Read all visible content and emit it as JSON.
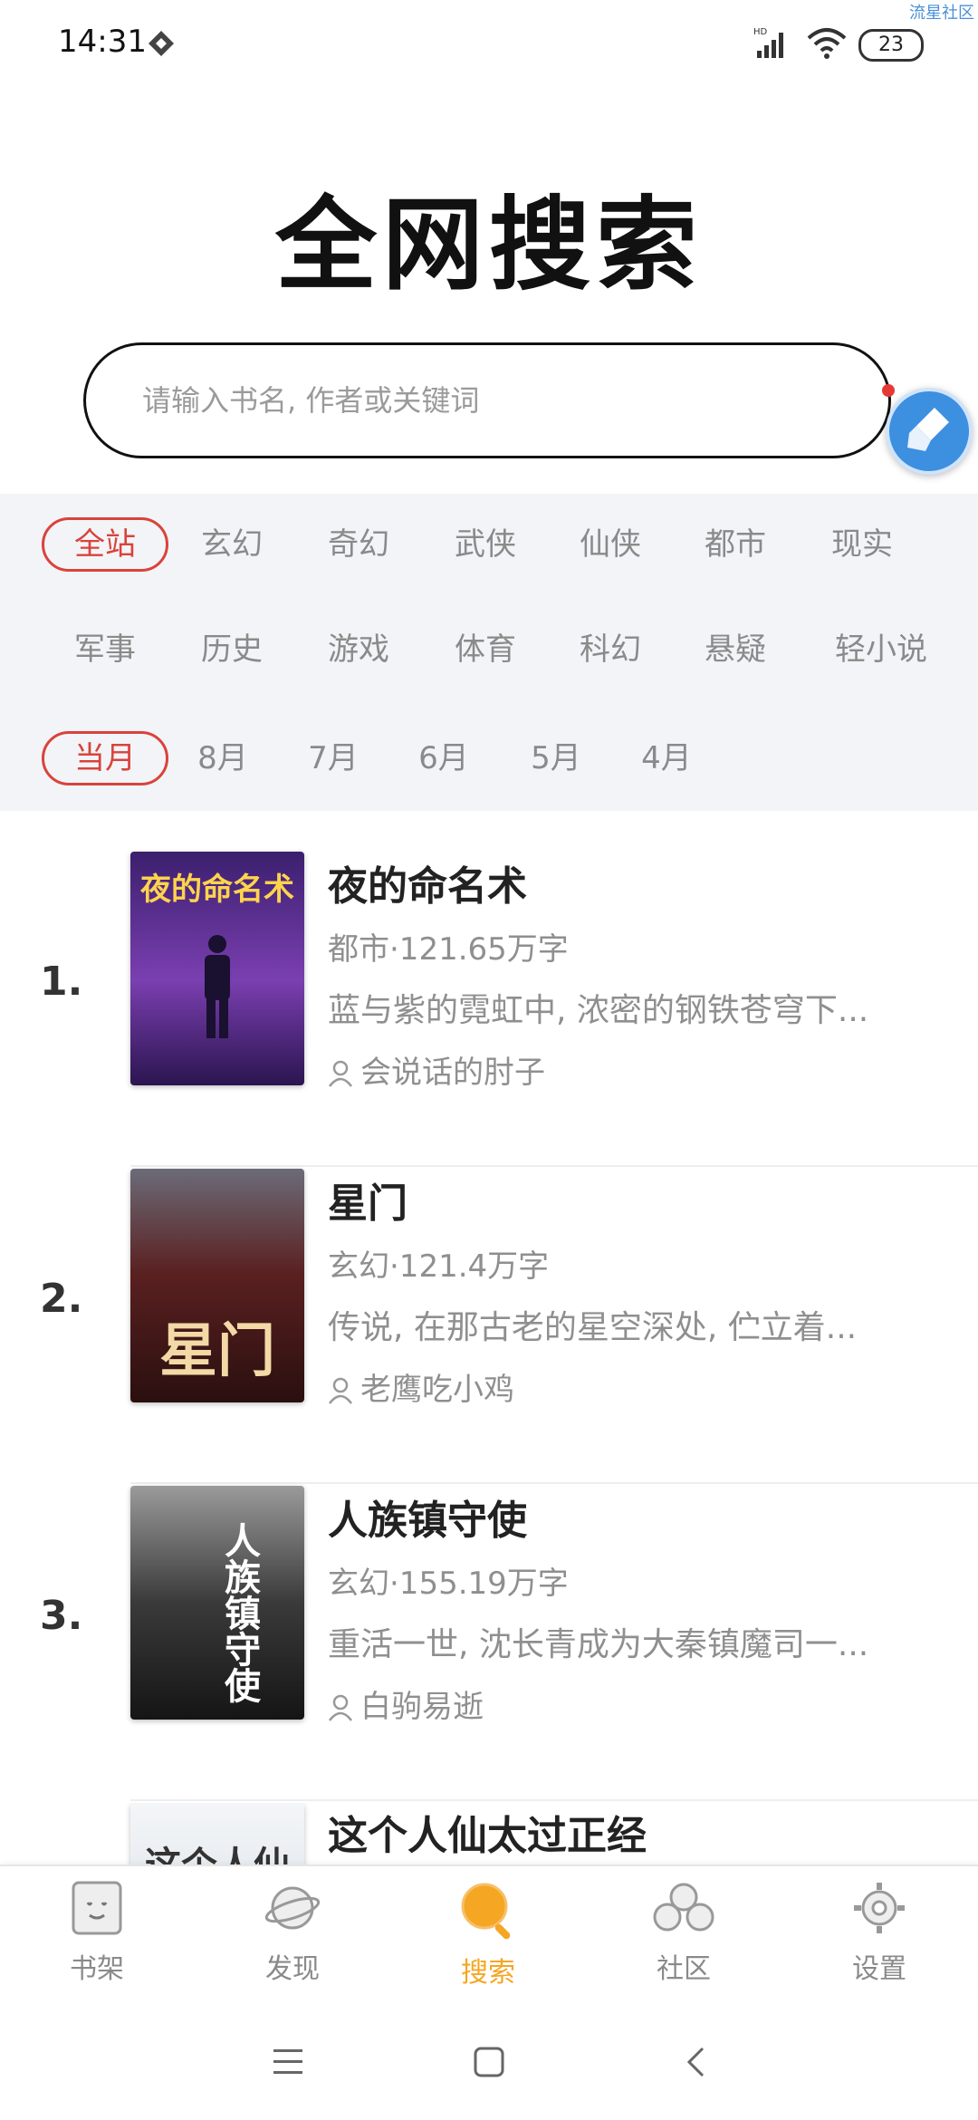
{
  "status_bar": {
    "time": "14:31",
    "battery": "23",
    "watermark": "流星社区"
  },
  "page_title": "全网搜索",
  "search": {
    "placeholder": "请输入书名, 作者或关键词"
  },
  "categories": [
    [
      "全站",
      "玄幻",
      "奇幻",
      "武侠",
      "仙侠",
      "都市",
      "现实"
    ],
    [
      "军事",
      "历史",
      "游戏",
      "体育",
      "科幻",
      "悬疑",
      "轻小说"
    ]
  ],
  "months": [
    "当月",
    "8月",
    "7月",
    "6月",
    "5月",
    "4月"
  ],
  "books": [
    {
      "rank": "1.",
      "title": "夜的命名术",
      "meta": "都市·121.65万字",
      "desc": "蓝与紫的霓虹中, 浓密的钢铁苍穹下...",
      "author": "会说话的肘子",
      "cover_text": "夜的命名术",
      "cover_color": "#5a2d8c"
    },
    {
      "rank": "2.",
      "title": "星门",
      "meta": "玄幻·121.4万字",
      "desc": "传说, 在那古老的星空深处, 伫立着...",
      "author": "老鹰吃小鸡",
      "cover_text": "星门",
      "cover_color": "#4a1c1c"
    },
    {
      "rank": "3.",
      "title": "人族镇守使",
      "meta": "玄幻·155.19万字",
      "desc": "重活一世, 沈长青成为大秦镇魔司一...",
      "author": "白驹易逝",
      "cover_text": "人族镇守使",
      "cover_color": "#2a2a2a"
    },
    {
      "rank": "",
      "title": "这个人仙太过正经",
      "meta": "",
      "desc": "",
      "author": "",
      "cover_text": "这个人仙",
      "cover_color": "#dfe7ee"
    }
  ],
  "tabs": [
    {
      "label": "书架",
      "icon": "bookshelf-icon"
    },
    {
      "label": "发现",
      "icon": "planet-icon"
    },
    {
      "label": "搜索",
      "icon": "search-icon",
      "active": true
    },
    {
      "label": "社区",
      "icon": "community-icon"
    },
    {
      "label": "设置",
      "icon": "gear-icon"
    }
  ],
  "colors": {
    "accent_red": "#d9433b",
    "tab_active": "#f5a623",
    "filter_bg": "#f2f4f7"
  }
}
